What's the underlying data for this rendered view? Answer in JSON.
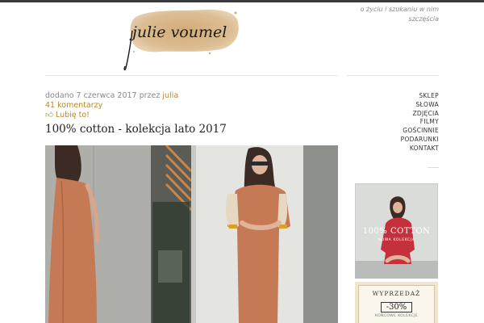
{
  "header": {
    "logo_text": "julie voumel",
    "tagline": "o życiu i szukaniu w nim szczęścia"
  },
  "post": {
    "meta_prefix": "dodano 7 czerwca 2017 przez",
    "author": "julia",
    "comments": "41 komentarzy",
    "like_label": "Lubię to!",
    "title": "100% cotton - kolekcja lato 2017"
  },
  "sidebar": {
    "nav": [
      "SKLEP",
      "SŁOWA",
      "ZDJĘCIA",
      "FILMY",
      "GOŚCINNIE",
      "PODARUNKI",
      "KONTAKT"
    ],
    "banner1": {
      "title": "100% COTTON",
      "subtitle": "NOWA KOLEKCJA"
    },
    "banner2": {
      "title": "WYPRZEDAŻ",
      "discount": "-30%",
      "subtitle": "KOŃCOWE KOLEKCJE"
    }
  },
  "colors": {
    "accent": "#b58a2a",
    "top_bar": "#3a3a3a",
    "dress": "#c57a55",
    "logo_wash": "#d8b98e"
  }
}
